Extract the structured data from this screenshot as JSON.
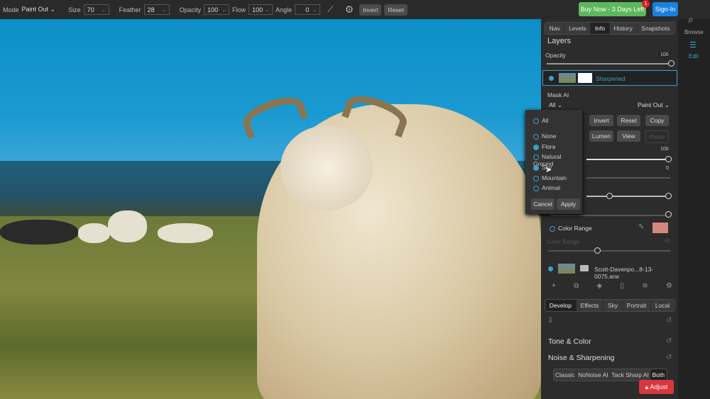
{
  "toolbar": {
    "mode_label": "Mode",
    "mode_value": "Paint Out",
    "size_label": "Size",
    "size_value": "70",
    "feather_label": "Feather",
    "feather_value": "28",
    "opacity_label": "Opacity",
    "opacity_value": "100",
    "flow_label": "Flow",
    "flow_value": "100",
    "angle_label": "Angle",
    "angle_value": "0",
    "invert": "Invert",
    "reset": "Reset",
    "buy_now": "Buy Now - 3 Days Left",
    "badge": "1",
    "sign_in": "Sign-In"
  },
  "strip": {
    "browse": "Browse",
    "edit": "Edit"
  },
  "panel": {
    "tabs": [
      "Nav",
      "Levels",
      "Info",
      "History",
      "Snapshots"
    ],
    "active_tab": "Info",
    "layers_title": "Layers",
    "opacity_label": "Opacity",
    "opacity_value": "100",
    "layer_name": "Sharpened",
    "mask_ai_label": "Mask AI",
    "mask_select": "All",
    "mask_mode": "Paint Out",
    "buttons": [
      "Invert",
      "Reset",
      "Copy",
      "Lumen",
      "View",
      "Paste"
    ],
    "slider1_value": "100",
    "slider2_value": "0",
    "color_range_label": "Color Range",
    "color_range_sub": "Color Range",
    "color_range_value": "40",
    "base_layer": "Scott-Davenpo...8-13-0075.arw",
    "bottom_tabs": [
      "Develop",
      "Effects",
      "Sky",
      "Portrait",
      "Local"
    ],
    "tone_color": "Tone & Color",
    "noise_sharpening": "Noise & Sharpening",
    "noise_tabs": [
      "Classic",
      "NoNoise AI",
      "Tack Sharp AI",
      "Both"
    ],
    "adjust": "Adjust",
    "swatch_color": "#d4877e",
    "accent": "#3aa0c8"
  },
  "popup": {
    "items": [
      {
        "label": "All",
        "checked": false
      },
      {
        "label": "None",
        "checked": false
      },
      {
        "label": "Flora",
        "checked": true
      },
      {
        "label": "Natural Ground",
        "checked": false
      },
      {
        "label": "Sky",
        "checked": true
      },
      {
        "label": "Mountain",
        "checked": false
      },
      {
        "label": "Animal",
        "checked": false
      }
    ],
    "cancel": "Cancel",
    "apply": "Apply"
  }
}
